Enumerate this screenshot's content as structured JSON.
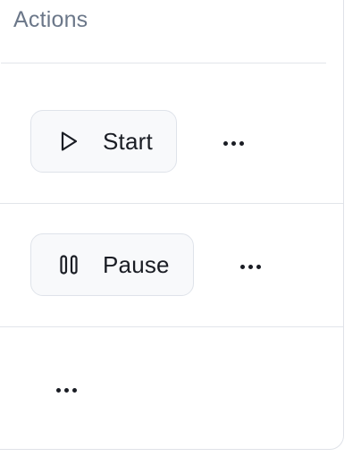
{
  "table": {
    "header": {
      "actions_label": "Actions"
    },
    "rows": [
      {
        "primary_action": {
          "label": "Start",
          "icon": "play-icon"
        },
        "more_icon": "more-horizontal-icon"
      },
      {
        "primary_action": {
          "label": "Pause",
          "icon": "pause-icon"
        },
        "more_icon": "more-horizontal-icon"
      },
      {
        "more_icon": "more-horizontal-icon"
      }
    ]
  },
  "colors": {
    "border": "#dfe2e8",
    "header_text": "#6b7789",
    "button_bg": "#f8f9fb",
    "text": "#1a1d24"
  }
}
